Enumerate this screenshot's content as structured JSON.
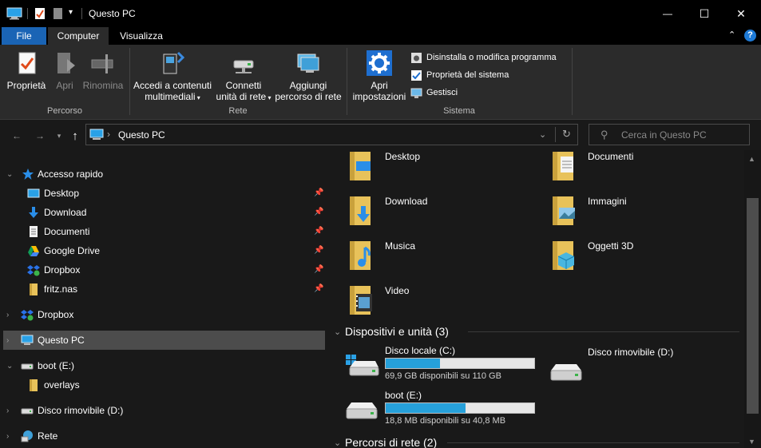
{
  "window": {
    "title": "Questo PC",
    "minimize_glyph": "—",
    "maximize_glyph": "☐",
    "close_glyph": "✕"
  },
  "ribbon_tabs": [
    {
      "label": "File"
    },
    {
      "label": "Computer"
    },
    {
      "label": "Visualizza"
    }
  ],
  "ribbon": {
    "groups": {
      "percorso": "Percorso",
      "rete": "Rete",
      "sistema": "Sistema"
    },
    "buttons": {
      "proprieta": "Proprietà",
      "apri": "Apri",
      "rinomina": "Rinomina",
      "accedi_line1": "Accedi a contenuti",
      "accedi_line2": "multimediali",
      "connetti_line1": "Connetti",
      "connetti_line2": "unità di rete",
      "aggiungi_line1": "Aggiungi",
      "aggiungi_line2": "percorso di rete",
      "apri_imp_line1": "Apri",
      "apri_imp_line2": "impostazioni"
    },
    "small_buttons": {
      "disinstalla": "Disinstalla o modifica programma",
      "proprieta_sistema": "Proprietà del sistema",
      "gestisci": "Gestisci"
    }
  },
  "address": {
    "path": "Questo PC",
    "separator": "›"
  },
  "search": {
    "placeholder": "Cerca in Questo PC"
  },
  "nav_pane": {
    "accesso_rapido": "Accesso rapido",
    "quick_items": [
      {
        "label": "Desktop",
        "icon": "desktop-icon"
      },
      {
        "label": "Download",
        "icon": "download-icon"
      },
      {
        "label": "Documenti",
        "icon": "document-icon"
      },
      {
        "label": "Google Drive",
        "icon": "google-drive-icon"
      },
      {
        "label": "Dropbox",
        "icon": "dropbox-icon"
      },
      {
        "label": "fritz.nas",
        "icon": "folder-icon"
      }
    ],
    "dropbox": "Dropbox",
    "questo_pc": "Questo PC",
    "boot": "boot (E:)",
    "overlays": "overlays",
    "disco_rimovibile": "Disco rimovibile (D:)",
    "rete": "Rete"
  },
  "folders": [
    {
      "label": "Desktop"
    },
    {
      "label": "Documenti"
    },
    {
      "label": "Download"
    },
    {
      "label": "Immagini"
    },
    {
      "label": "Musica"
    },
    {
      "label": "Oggetti 3D"
    },
    {
      "label": "Video"
    }
  ],
  "sections": {
    "dispositivi": "Dispositivi e unità (3)",
    "percorsi": "Percorsi di rete (2)"
  },
  "drives": {
    "c": {
      "name": "Disco locale (C:)",
      "space": "69,9 GB disponibili su 110 GB",
      "used_fraction": 0.365
    },
    "d": {
      "name": "Disco rimovibile (D:)"
    },
    "e": {
      "name": "boot (E:)",
      "space": "18,8 MB disponibili su 40,8 MB",
      "used_fraction": 0.54
    }
  },
  "colors": {
    "accent": "#1a64b5",
    "bar_fill": "#26a0da",
    "folder": "#e8c25a"
  }
}
